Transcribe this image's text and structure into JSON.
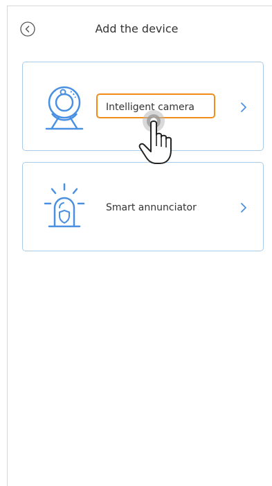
{
  "header": {
    "title": "Add the device",
    "back_icon": "back-chevron-circle-icon"
  },
  "devices": [
    {
      "label": "Intelligent camera",
      "icon": "webcam-icon",
      "highlighted": true,
      "highlight_color": "#f08c1a"
    },
    {
      "label": "Smart annunciator",
      "icon": "alarm-siren-icon",
      "highlighted": false
    }
  ],
  "colors": {
    "icon_blue": "#4a90e2",
    "card_border": "#a9cbea",
    "chevron": "#4a90e2"
  },
  "overlay": {
    "pointer": "hand-tap-cursor-icon"
  }
}
